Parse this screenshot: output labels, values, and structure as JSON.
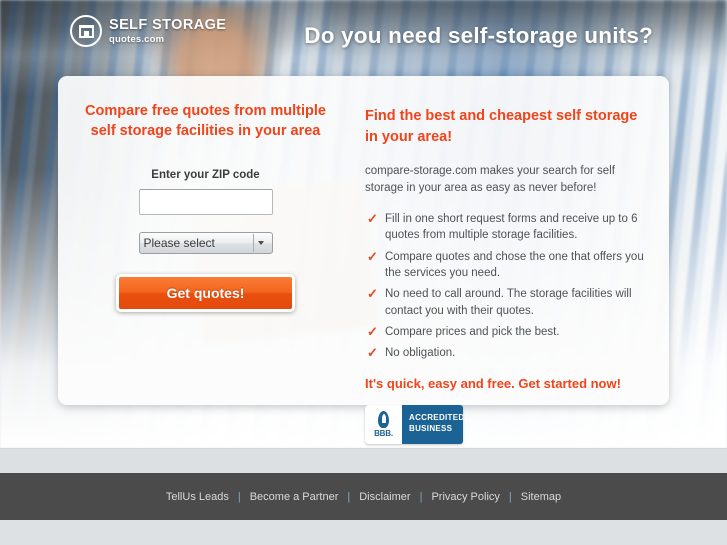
{
  "brand": {
    "logo_icon": "storage-box-circle-icon",
    "name_line1": "SELF STORAGE",
    "name_line2": "quotes.com"
  },
  "hero": {
    "headline": "Do you need self-storage units?"
  },
  "form": {
    "heading": "Compare free quotes from multiple self storage facilities in your area",
    "zip_label": "Enter your ZIP code",
    "zip_value": "",
    "zip_placeholder": "",
    "select_value": "Please select",
    "select_icon": "chevron-down-icon",
    "submit_label": "Get quotes!"
  },
  "copy": {
    "heading": "Find the best and cheapest self storage in your area!",
    "intro": "compare-storage.com makes your search for self storage in your area as easy as never before!",
    "bullet_icon": "check-icon",
    "bullets": [
      "Fill in one short request forms and receive up to 6 quotes from multiple storage facilities.",
      "Compare quotes and chose the one that offers you the services you need.",
      "No need to call around. The storage facilities will contact you with their quotes.",
      "Compare prices and pick the best.",
      "No obligation."
    ],
    "cta": "It's quick, easy and free. Get started now!"
  },
  "bbb": {
    "icon": "bbb-torch-icon",
    "abbr": "BBB.",
    "line1": "ACCREDITED",
    "line2": "BUSINESS"
  },
  "footer": {
    "separator": "|",
    "links": [
      "TellUs Leads",
      "Become a Partner",
      "Disclaimer",
      "Privacy Policy",
      "Sitemap"
    ]
  },
  "colors": {
    "accent_orange": "#f0441a",
    "button_orange": "#e9500f",
    "bbb_blue": "#1b6394",
    "footer_gray": "#4b4b4b",
    "band_gray": "#dce0e2",
    "body_text": "#4e5255"
  }
}
